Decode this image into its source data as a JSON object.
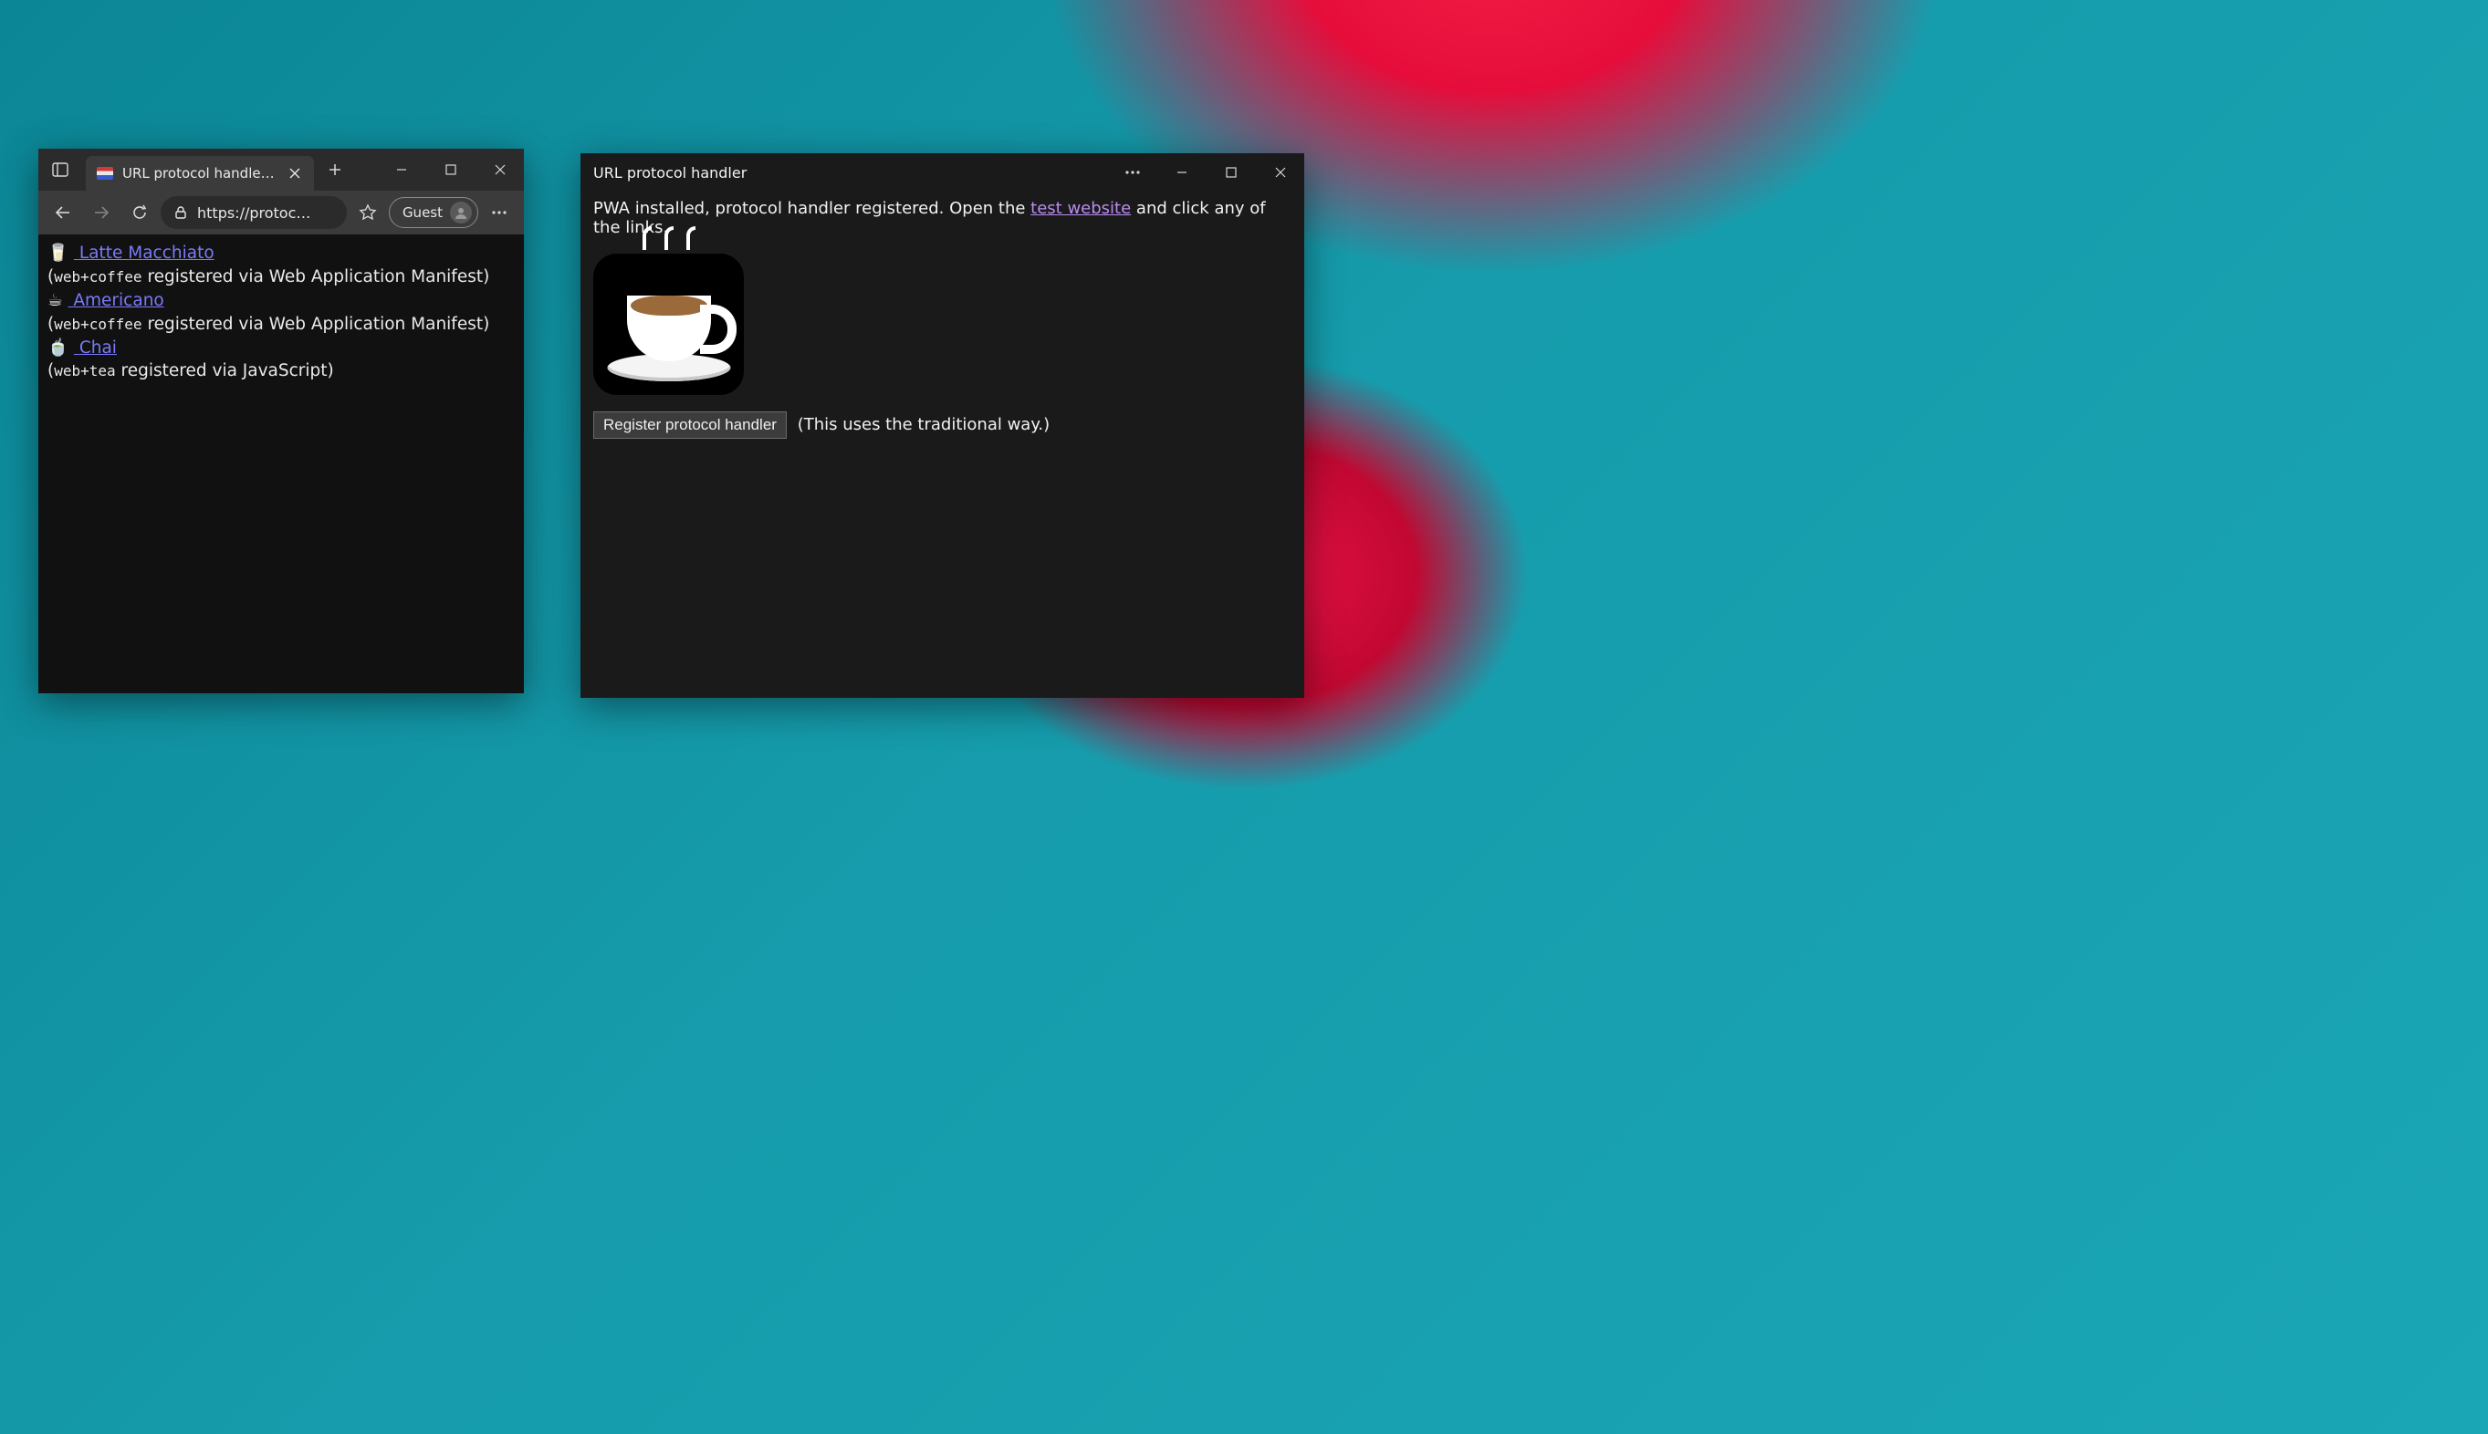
{
  "browser": {
    "tab_title": "URL protocol handler links",
    "address": "https://protoc…",
    "guest_label": "Guest",
    "links": [
      {
        "emoji": "🥛",
        "label": "Latte Macchiato",
        "scheme": "web+coffee",
        "via": "registered via Web Application Manifest"
      },
      {
        "emoji": "☕",
        "label": "Americano",
        "scheme": "web+coffee",
        "via": "registered via Web Application Manifest"
      },
      {
        "emoji": "🍵",
        "label": "Chai",
        "scheme": "web+tea",
        "via": "registered via JavaScript"
      }
    ]
  },
  "pwa": {
    "title": "URL protocol handler",
    "msg_pre": "PWA installed, protocol handler registered. Open the ",
    "msg_link": "test website",
    "msg_post": " and click any of the links.",
    "register_button": "Register protocol handler",
    "register_hint": "(This uses the traditional way.)"
  }
}
